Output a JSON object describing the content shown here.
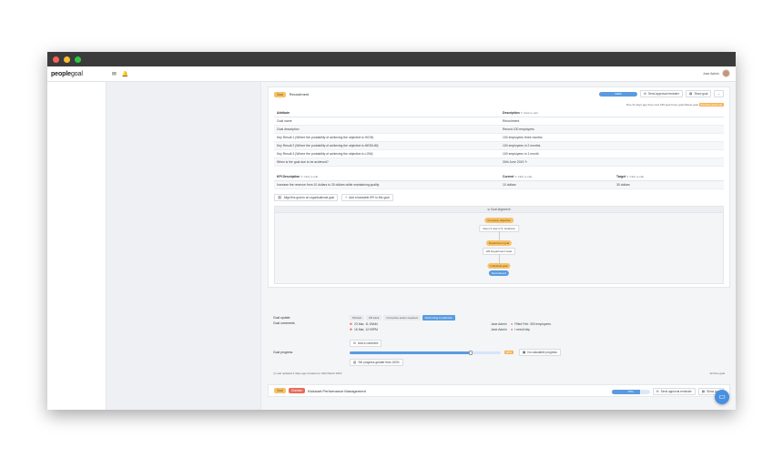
{
  "app": {
    "logo_bold": "people",
    "logo_rest": "goal",
    "user_name": "Jose Admin"
  },
  "goal1": {
    "tag": "Goal",
    "title": "Recruitment",
    "progress_pct": 100,
    "progress_label": "100%",
    "send_approval": "Send approval reminder",
    "show_goal": "Show goal",
    "meta": "Due 31 days ago  Free now  183 goal  Copy goal  Delete goal",
    "meta_badge": "Pending approval",
    "attr_header": "Attribute",
    "desc_header": "Description",
    "click_edit": "Click to edit",
    "rows": [
      {
        "attribute": "Goal name",
        "description": "Recruitment"
      },
      {
        "attribute": "Goal description",
        "description": "Recruit 100 employees"
      },
      {
        "attribute": "Key Result 1 (Where the probability of achieving the objective is HIGH)",
        "description": "100 employees three months"
      },
      {
        "attribute": "Key Result 2 (Where the probability of achieving the objective is MEDIUM)",
        "description": "100 employees in 2 months"
      },
      {
        "attribute": "Key Result 3 (Where the probability of achieving the objective is LOW)",
        "description": "100 employees in 1 month"
      },
      {
        "attribute": "When is the goal due to be achieved?",
        "description": "30th June 2019"
      }
    ],
    "kpi_header": "KPI Description",
    "current_header": "Current",
    "target_header": "Target",
    "kpi_rows": [
      {
        "kpi": "Increase the revenue from 10 dollars to 30 dollars while maintaining quality",
        "current": "10 dollars",
        "target": "30 dollars"
      }
    ],
    "align_btn": "Align this goal to an organisational goal",
    "add_kpi_btn": "Add a trackable KPI to this goal",
    "alignment_title": "Goal alignment",
    "alignment": {
      "company_label": "Company objective",
      "company_goal": "Open 3 new U.S. locations",
      "dept_label": "Department goal",
      "dept_goal": "HR Department Goal",
      "individual_label": "Individual goal",
      "individual_goal": "Recruitment"
    }
  },
  "lower": {
    "goal_update_label": "Goal update",
    "update_options": [
      "Pitched",
      "Off track",
      "Corrective action required",
      "Performing to plan/Aim"
    ],
    "active_update": 3,
    "goal_comments_label": "Goal comments",
    "comments": [
      {
        "date": "23 Mar, 11:26AM",
        "author": "Jane Admin",
        "text": "Filled Feb: 300 employees"
      },
      {
        "date": "16 Mar, 12:09PM",
        "author": "Jane Admin",
        "text": "I need help"
      }
    ],
    "add_comment": "Add a comment",
    "goal_progress_label": "Goal progress",
    "progress_value": 0.8,
    "progress_pct_label": "80%",
    "no_calc": "No calculable progress",
    "set_progress": "Set progress greater than 100%",
    "last_updated": "Last updated 4 days ago  Created on 19th March 2019",
    "archive": "Archive goal"
  },
  "goal2": {
    "tag": "Goal",
    "tag2": "Overdue",
    "title": "Kickstart Performance Management",
    "progress_label": "75%",
    "progress_pct": 75,
    "send_approval": "Send approval reminder",
    "show_goal": "Show goal"
  }
}
